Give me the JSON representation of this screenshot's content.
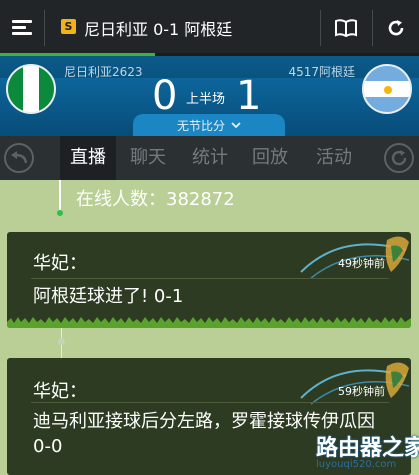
{
  "topbar": {
    "title": "尼日利亚 0-1 阿根廷",
    "app_icon": "app-logo-icon",
    "menu_icon": "menu-icon",
    "book_icon": "book-icon",
    "refresh_icon": "refresh-icon",
    "load_progress": 0.37
  },
  "match": {
    "home_team": "尼日利亚2623",
    "away_team": "4517阿根廷",
    "home_score": "0",
    "away_score": "1",
    "period": "上半场",
    "score_toggle": "无节比分",
    "home_flag": "nigeria-flag",
    "away_flag": "argentina-flag"
  },
  "tabs": [
    {
      "label": "直播",
      "active": true
    },
    {
      "label": "聊天",
      "active": false
    },
    {
      "label": "统计",
      "active": false
    },
    {
      "label": "回放",
      "active": false
    },
    {
      "label": "活动",
      "active": false
    }
  ],
  "feed": {
    "online_count": "在线人数：382872",
    "posts": [
      {
        "author": "华妃：",
        "time": "49秒钟前",
        "message": "阿根廷球进了! 0-1"
      },
      {
        "author": "华妃：",
        "time": "59秒钟前",
        "message": "迪马利亚接球后分左路，罗霍接球传伊瓜因 0-0"
      }
    ]
  },
  "watermark": {
    "text": "路由器之家",
    "url": "luyouqi520.com"
  },
  "colors": {
    "accent_green": "#3cb43c",
    "header_blue": "#0a5a8c",
    "card_bg": "#2c3b21",
    "page_bg": "#b9cf95"
  }
}
